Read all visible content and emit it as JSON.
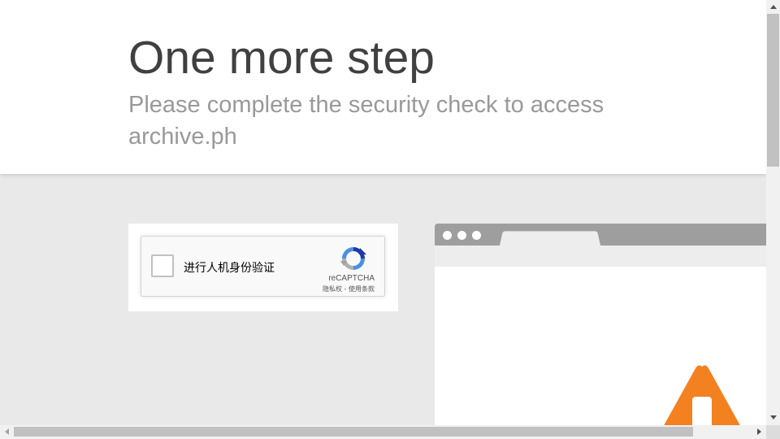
{
  "header": {
    "title": "One more step",
    "subtitle": "Please complete the security check to access archive.ph"
  },
  "captcha": {
    "checkbox_label": "进行人机身份验证",
    "brand": "reCAPTCHA",
    "links": "隐私权 - 使用条款",
    "logo_icon": "recaptcha-logo-icon"
  },
  "illustration": {
    "warning_icon": "warning-triangle-icon",
    "warning_color": "#f48120",
    "window_bar_color": "#9e9e9e"
  }
}
